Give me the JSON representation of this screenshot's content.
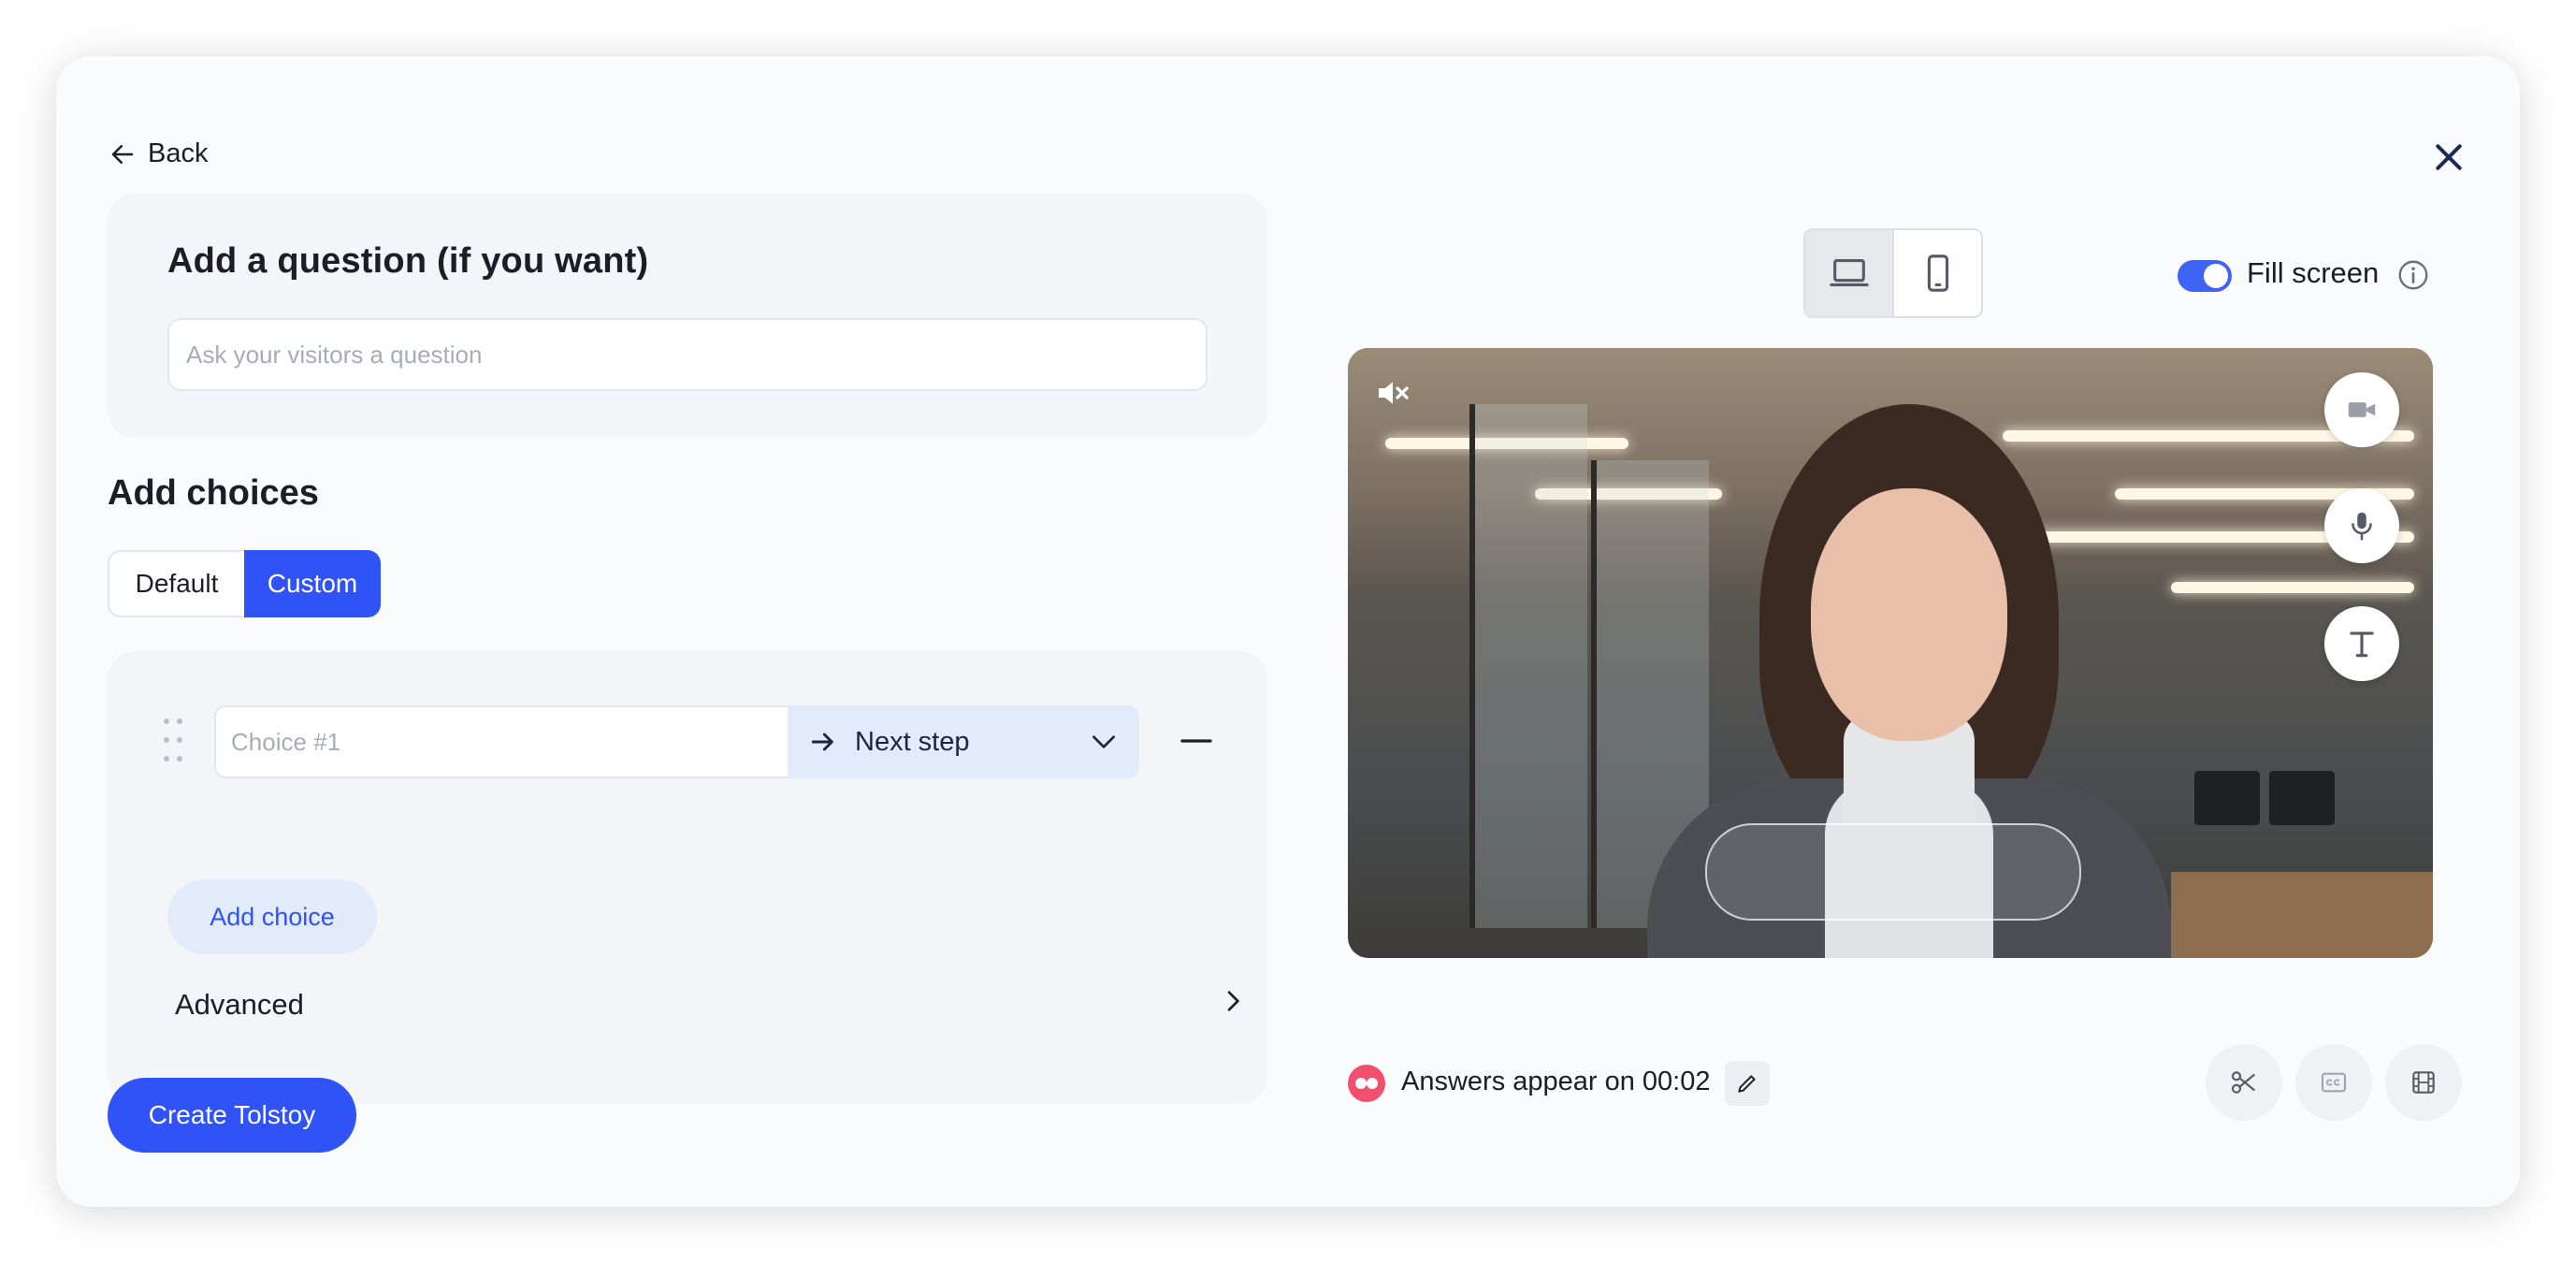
{
  "header": {
    "back_label": "Back"
  },
  "question": {
    "title": "Add a question (if you want)",
    "input_placeholder": "Ask your visitors a question",
    "input_value": ""
  },
  "choices": {
    "title": "Add choices",
    "segments": [
      "Default",
      "Custom"
    ],
    "selected_segment": "Custom",
    "items": [
      {
        "placeholder": "Choice #1",
        "value": "",
        "action": "Next step"
      }
    ],
    "add_label": "Add choice",
    "advanced_label": "Advanced"
  },
  "footer": {
    "create_label": "Create Tolstoy"
  },
  "preview": {
    "device_options": [
      "desktop-icon",
      "mobile-icon"
    ],
    "selected_device": "desktop",
    "fill_screen_label": "Fill screen",
    "fill_screen_on": true,
    "answers_appear_text": "Answers appear on 00:02",
    "side_buttons": [
      "video-camera-icon",
      "microphone-icon",
      "text-icon"
    ],
    "tools": [
      "scissors-icon",
      "closed-captions-icon",
      "film-icon"
    ]
  },
  "colors": {
    "accent": "#3053f7",
    "accent_light": "#e1ebfc",
    "brand_pink": "#f0506e"
  }
}
